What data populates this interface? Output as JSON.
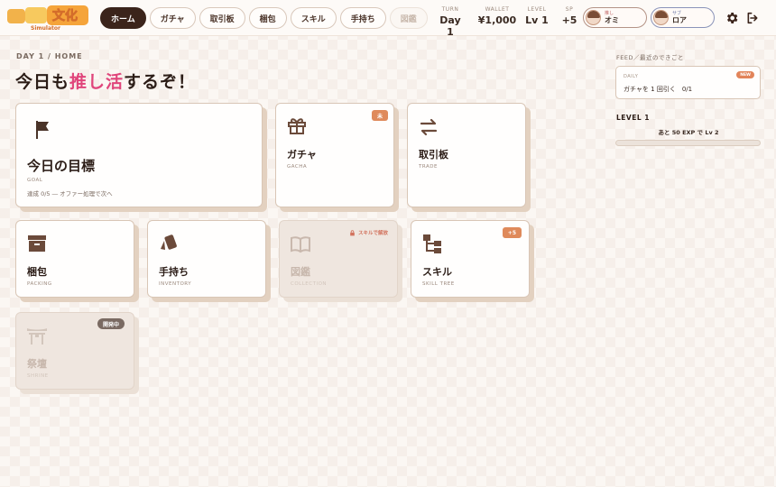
{
  "logo": {
    "text": "Simulator"
  },
  "nav": [
    {
      "label": "ホーム",
      "state": "active"
    },
    {
      "label": "ガチャ",
      "state": "normal"
    },
    {
      "label": "取引板",
      "state": "normal"
    },
    {
      "label": "梱包",
      "state": "normal"
    },
    {
      "label": "スキル",
      "state": "normal"
    },
    {
      "label": "手持ち",
      "state": "normal"
    },
    {
      "label": "図鑑",
      "state": "disabled"
    }
  ],
  "stats": {
    "turn": {
      "label": "TURN",
      "value": "Day 1"
    },
    "wallet": {
      "label": "WALLET",
      "value": "¥1,000"
    },
    "level": {
      "label": "LEVEL",
      "value": "Lv 1"
    },
    "sp": {
      "label": "SP",
      "value": "+5"
    }
  },
  "characters": [
    {
      "role": "推し",
      "name": "オミ",
      "accent": "#b49386"
    },
    {
      "role": "サブ",
      "name": "ロア",
      "accent": "#8a93b9"
    }
  ],
  "breadcrumb": "DAY 1 / HOME",
  "headline": {
    "part1": "今日も",
    "highlight": "推し活",
    "part2": "するぞ！",
    "highlight_color": "#e0457b"
  },
  "cards": {
    "goal": {
      "title": "今日の目標",
      "sub": "GOAL",
      "progress": "達成 0/5 ― オファー処理で次へ",
      "icon": "flag-icon"
    },
    "gacha": {
      "title": "ガチャ",
      "sub": "GACHA",
      "badge": "未",
      "icon": "gift-box-icon"
    },
    "trade": {
      "title": "取引板",
      "sub": "TRADE",
      "icon": "swap-arrows-icon"
    },
    "packing": {
      "title": "梱包",
      "sub": "PACKING",
      "icon": "box-icon"
    },
    "inventory": {
      "title": "手持ち",
      "sub": "INVENTORY",
      "icon": "cards-icon"
    },
    "collection": {
      "title": "図鑑",
      "sub": "COLLECTION",
      "lock": "スキルで解放",
      "icon": "open-book-icon"
    },
    "skill": {
      "title": "スキル",
      "sub": "SKILL TREE",
      "badge": "+5",
      "icon": "skill-tree-icon"
    },
    "shrine": {
      "title": "祭壇",
      "sub": "SHRINE",
      "badge": "開発中",
      "icon": "shrine-icon"
    }
  },
  "feed": {
    "label": "FEED／最近のできごと",
    "kind": "DAILY",
    "message": "ガチャを 1 回引く　0/1",
    "new_badge": "NEW"
  },
  "level_panel": {
    "label": "LEVEL 1",
    "next": "あと 50 EXP で Lv 2",
    "progress": 0
  }
}
